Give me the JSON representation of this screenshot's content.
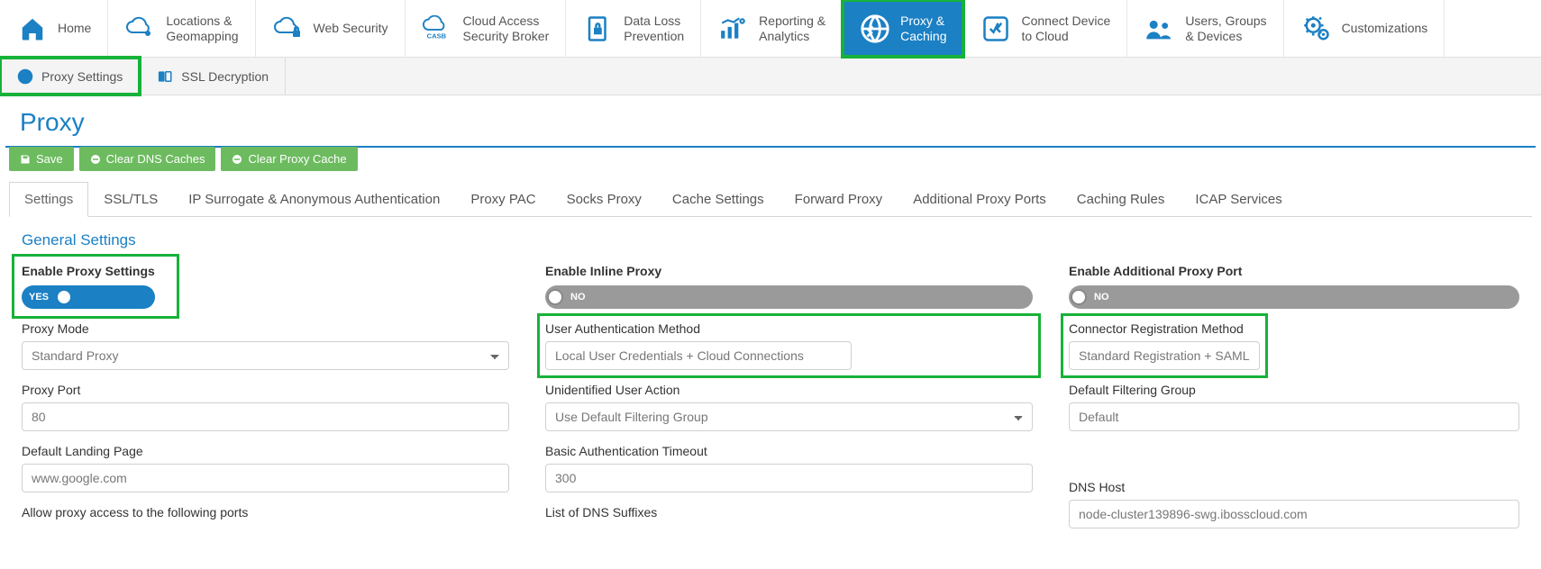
{
  "topnav": [
    {
      "label_l1": "Home",
      "label_l2": "",
      "icon": "home",
      "active": false,
      "highlight": false
    },
    {
      "label_l1": "Locations &",
      "label_l2": "Geomapping",
      "icon": "cloud-pin",
      "active": false,
      "highlight": false
    },
    {
      "label_l1": "Web Security",
      "label_l2": "",
      "icon": "cloud-lock",
      "active": false,
      "highlight": false
    },
    {
      "label_l1": "Cloud Access",
      "label_l2": "Security Broker",
      "icon": "casb",
      "active": false,
      "highlight": false
    },
    {
      "label_l1": "Data Loss",
      "label_l2": "Prevention",
      "icon": "file-lock",
      "active": false,
      "highlight": false
    },
    {
      "label_l1": "Reporting &",
      "label_l2": "Analytics",
      "icon": "analytics",
      "active": false,
      "highlight": false
    },
    {
      "label_l1": "Proxy &",
      "label_l2": "Caching",
      "icon": "globe",
      "active": true,
      "highlight": true
    },
    {
      "label_l1": "Connect Device",
      "label_l2": "to Cloud",
      "icon": "connect",
      "active": false,
      "highlight": false
    },
    {
      "label_l1": "Users, Groups",
      "label_l2": "& Devices",
      "icon": "users",
      "active": false,
      "highlight": false
    },
    {
      "label_l1": "Customizations",
      "label_l2": "",
      "icon": "gear",
      "active": false,
      "highlight": false
    }
  ],
  "subnav": [
    {
      "label": "Proxy Settings",
      "icon": "globe-sm",
      "highlight": true
    },
    {
      "label": "SSL Decryption",
      "icon": "ssl",
      "highlight": false
    }
  ],
  "page_title": "Proxy",
  "actions": {
    "save": "Save",
    "clear_dns": "Clear DNS Caches",
    "clear_proxy": "Clear Proxy Cache"
  },
  "tabs": [
    {
      "label": "Settings",
      "active": true
    },
    {
      "label": "SSL/TLS",
      "active": false
    },
    {
      "label": "IP Surrogate & Anonymous Authentication",
      "active": false
    },
    {
      "label": "Proxy PAC",
      "active": false
    },
    {
      "label": "Socks Proxy",
      "active": false
    },
    {
      "label": "Cache Settings",
      "active": false
    },
    {
      "label": "Forward Proxy",
      "active": false
    },
    {
      "label": "Additional Proxy Ports",
      "active": false
    },
    {
      "label": "Caching Rules",
      "active": false
    },
    {
      "label": "ICAP Services",
      "active": false
    }
  ],
  "section_title": "General Settings",
  "col1": {
    "enable_label": "Enable Proxy Settings",
    "enable_value": "YES",
    "proxy_mode_label": "Proxy Mode",
    "proxy_mode_value": "Standard Proxy",
    "proxy_port_label": "Proxy Port",
    "proxy_port_value": "80",
    "landing_label": "Default Landing Page",
    "landing_value": "www.google.com",
    "allow_ports_label": "Allow proxy access to the following ports"
  },
  "col2": {
    "enable_inline_label": "Enable Inline Proxy",
    "enable_inline_value": "NO",
    "auth_method_label": "User Authentication Method",
    "auth_method_value": "Local User Credentials + Cloud Connections",
    "unidentified_label": "Unidentified User Action",
    "unidentified_value": "Use Default Filtering Group",
    "basic_auth_label": "Basic Authentication Timeout",
    "basic_auth_value": "300",
    "dns_suffixes_label": "List of DNS Suffixes"
  },
  "col3": {
    "enable_addl_label": "Enable Additional Proxy Port",
    "enable_addl_value": "NO",
    "connector_label": "Connector Registration Method",
    "connector_value": "Standard Registration + SAML",
    "filtering_label": "Default Filtering Group",
    "filtering_value": "Default",
    "dns_host_label": "DNS Host",
    "dns_host_value": "node-cluster139896-swg.ibosscloud.com"
  }
}
